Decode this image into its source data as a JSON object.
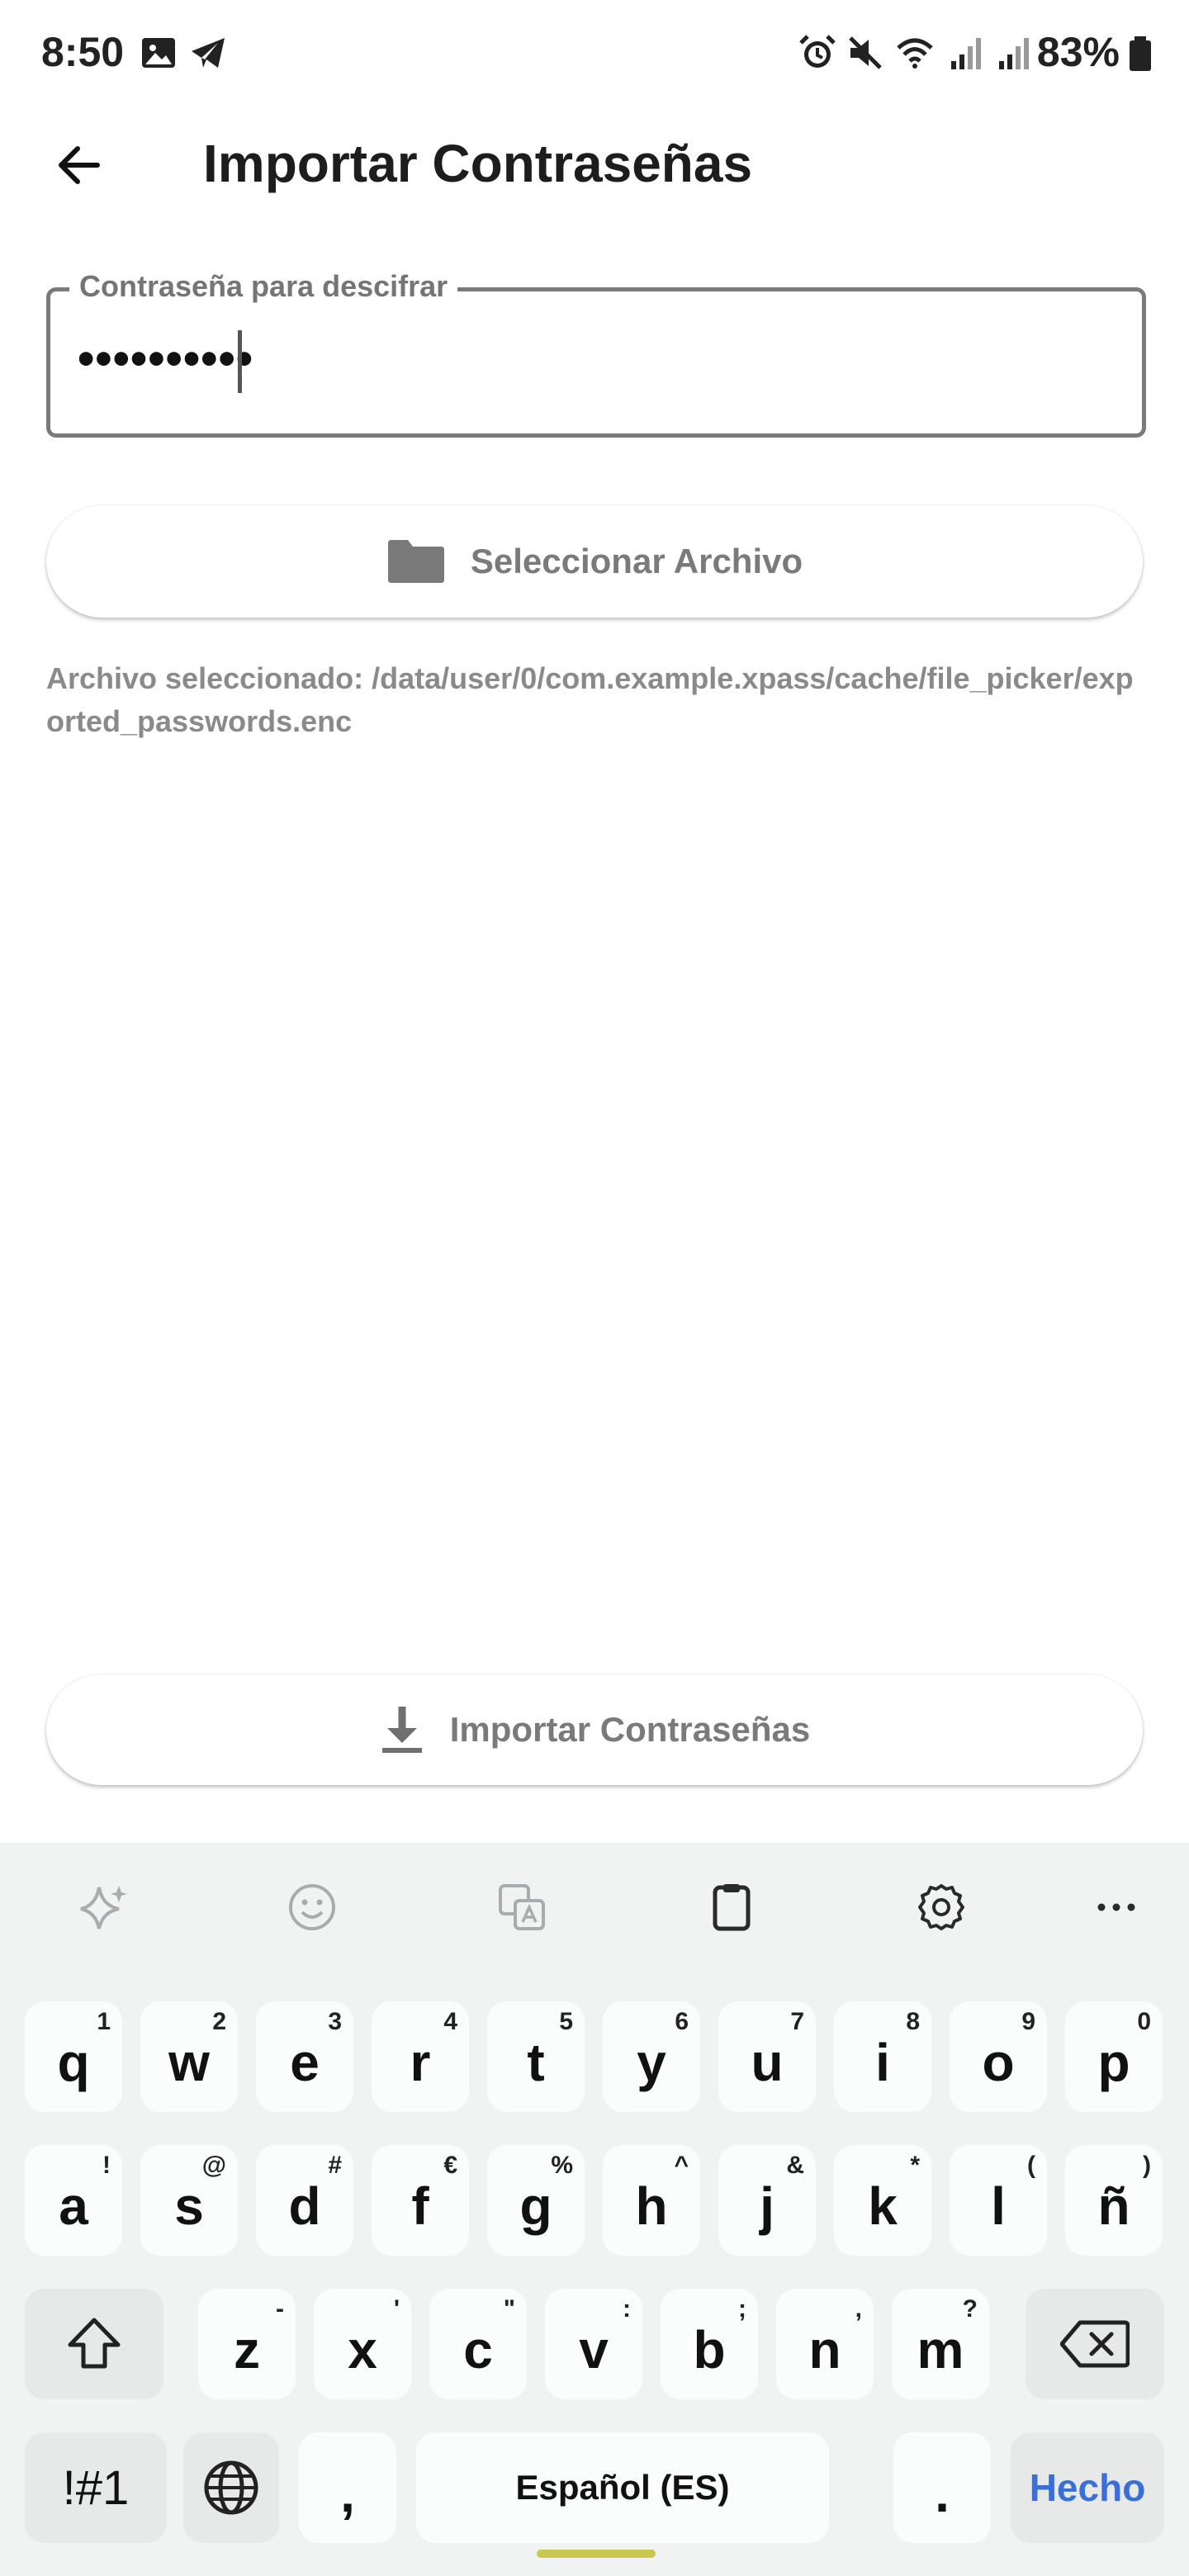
{
  "status": {
    "time": "8:50",
    "battery": "83%"
  },
  "header": {
    "title": "Importar Contraseñas"
  },
  "password_field": {
    "label": "Contraseña para descifrar",
    "value": "••••••••••"
  },
  "select_file_button": {
    "label": "Seleccionar Archivo",
    "icon": "folder-icon"
  },
  "file_info": {
    "text": "Archivo seleccionado: /data/user/0/com.example.xpass/cache/file_picker/exported_passwords.enc"
  },
  "import_button": {
    "label": "Importar Contraseñas",
    "icon": "download-icon"
  },
  "keyboard": {
    "toolbar": [
      "sparkle-icon",
      "emoji-icon",
      "translate-icon",
      "clipboard-icon",
      "settings-icon",
      "more-icon"
    ],
    "row1": [
      {
        "k": "q",
        "s": "1"
      },
      {
        "k": "w",
        "s": "2"
      },
      {
        "k": "e",
        "s": "3"
      },
      {
        "k": "r",
        "s": "4"
      },
      {
        "k": "t",
        "s": "5"
      },
      {
        "k": "y",
        "s": "6"
      },
      {
        "k": "u",
        "s": "7"
      },
      {
        "k": "i",
        "s": "8"
      },
      {
        "k": "o",
        "s": "9"
      },
      {
        "k": "p",
        "s": "0"
      }
    ],
    "row2": [
      {
        "k": "a",
        "s": "!"
      },
      {
        "k": "s",
        "s": "@"
      },
      {
        "k": "d",
        "s": "#"
      },
      {
        "k": "f",
        "s": "€"
      },
      {
        "k": "g",
        "s": "%"
      },
      {
        "k": "h",
        "s": "^"
      },
      {
        "k": "j",
        "s": "&"
      },
      {
        "k": "k",
        "s": "*"
      },
      {
        "k": "l",
        "s": "("
      },
      {
        "k": "ñ",
        "s": ")"
      }
    ],
    "row3": [
      {
        "k": "z",
        "s": "-"
      },
      {
        "k": "x",
        "s": "'"
      },
      {
        "k": "c",
        "s": "\""
      },
      {
        "k": "v",
        "s": ":"
      },
      {
        "k": "b",
        "s": ";"
      },
      {
        "k": "n",
        "s": ","
      },
      {
        "k": "m",
        "s": "?"
      }
    ],
    "symbols_label": "!#1",
    "comma_label": ",",
    "space_label": "Español (ES)",
    "period_label": ".",
    "done_label": "Hecho",
    "done_color": "#3b6fd8"
  }
}
